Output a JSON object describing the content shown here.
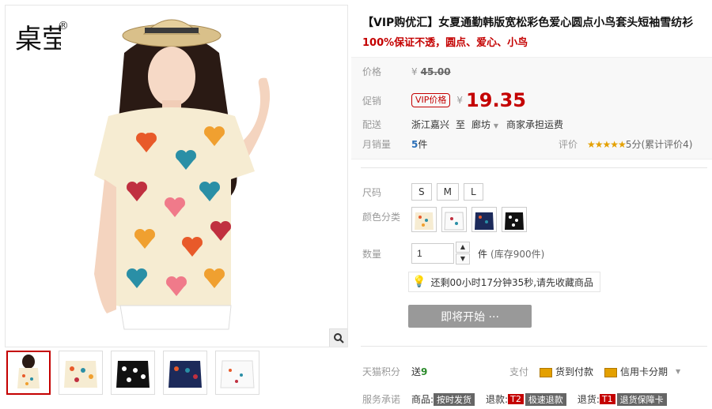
{
  "gallery": {
    "logo_text": "桌莹",
    "logo_mark": "®",
    "thumbnails": [
      "model",
      "white-hearts",
      "black-dots",
      "navy-hearts",
      "white-print"
    ]
  },
  "product": {
    "title": "【VIP购优汇】女夏通勤韩版宽松彩色爱心圆点小鸟套头短袖雪纺衫",
    "subtitle": "100%保证不透，圆点、爱心、小鸟"
  },
  "price": {
    "label_price": "价格",
    "yen": "¥",
    "original": "45.00",
    "label_promo": "促销",
    "vip_badge": "VIP价格",
    "promo": "19.35",
    "label_ship": "配送",
    "ship_from": "浙江嘉兴",
    "ship_to_word": "至",
    "ship_to": "廊坊",
    "ship_fee": "商家承担运费",
    "label_sales": "月销量",
    "sales_count": "5",
    "sales_unit": "件",
    "rating_label": "评价",
    "stars": "★★★★★",
    "rating_text": "5分(累计评价4)"
  },
  "options": {
    "size_label": "尺码",
    "sizes": [
      "S",
      "M",
      "L"
    ],
    "color_label": "颜色分类",
    "qty_label": "数量",
    "qty_value": "1",
    "qty_unit": "件",
    "stock": "(库存900件)",
    "tip": "还剩00小时17分钟35秒,请先收藏商品",
    "start_button": "即将开始 ···"
  },
  "services": {
    "points_label": "天猫积分",
    "points_text": "送",
    "points_value": "9",
    "pay_label": "支付",
    "cod": "货到付款",
    "credit": "信用卡分期",
    "promise_label": "服务承诺",
    "promise_goods": "商品:",
    "promise_goods_tag": "按时发货",
    "promise_refund": "退款:",
    "promise_refund_tag_badge": "T2",
    "promise_refund_tag": "极速退款",
    "promise_return": "退货:",
    "promise_return_tag_badge": "T1",
    "promise_return_tag": "退货保障卡"
  }
}
